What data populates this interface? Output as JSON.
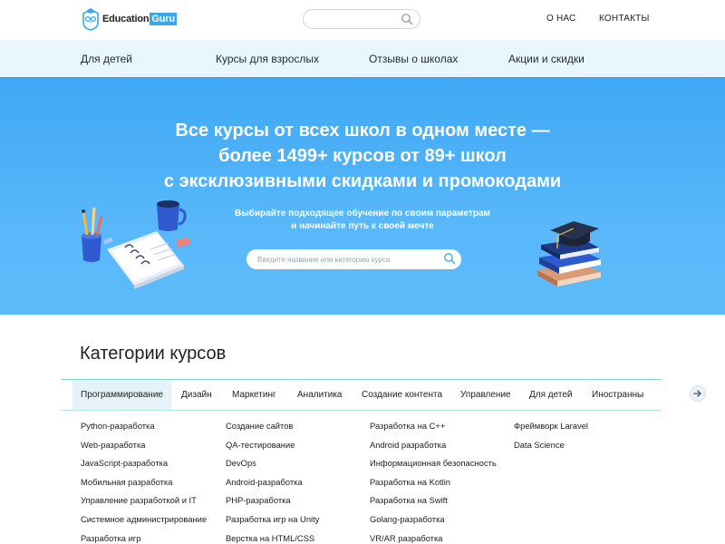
{
  "header": {
    "logo_text_1": "Education",
    "logo_text_2": "Guru",
    "search_placeholder": "",
    "links": [
      "О НАС",
      "КОНТАКТЫ"
    ]
  },
  "subnav": {
    "items": [
      "Для детей",
      "Курсы для взрослых",
      "Отзывы о школах",
      "Акции и скидки"
    ]
  },
  "hero": {
    "title_lines": [
      "Все курсы от всех школ в одном месте —",
      "более 1499+ курсов от 89+ школ",
      "с эксклюзивными скидками и промокодами"
    ],
    "subtitle_lines": [
      "Выбирайте подходящее обучение по своим параметрам",
      "и начинайте путь к своей мечте"
    ],
    "search_placeholder": "Введите название или категорию курса"
  },
  "categories": {
    "title": "Категории курсов",
    "tabs": [
      "Программирование",
      "Дизайн",
      "Маркетинг",
      "Аналитика",
      "Создание контента",
      "Управление",
      "Для детей",
      "Иностранные"
    ],
    "active_tab": "Программирование",
    "columns": [
      [
        "Python-разработка",
        "Web-разработка",
        "JavaScript-разработка",
        "Мобильная разработка",
        "Управление разработкой и IT",
        "Системное администрирование",
        "Разработка игр"
      ],
      [
        "Создание сайтов",
        "QA-тестирование",
        "DevOps",
        "Android-разработка",
        "PHP-разработка",
        "Разработка игр на Unity",
        "Верстка на HTML/CSS"
      ],
      [
        "Разработка на C++",
        "Android разработка",
        "Информационная безопасность",
        "Разработка на Kotlin",
        "Разработка на Swift",
        "Golang-разработка",
        "VR/AR разработка"
      ],
      [
        "Фреймворк Laravel",
        "Data Science"
      ]
    ]
  },
  "colors": {
    "accent": "#3aa7ea",
    "hero_top": "#3fa8f5",
    "hero_bottom": "#5cbcfb",
    "subnav_bg": "#e9f6fc",
    "tab_active_bg": "#e5f3f8"
  },
  "icons": [
    "logo-owl-icon",
    "search-icon",
    "arrow-right-icon"
  ]
}
